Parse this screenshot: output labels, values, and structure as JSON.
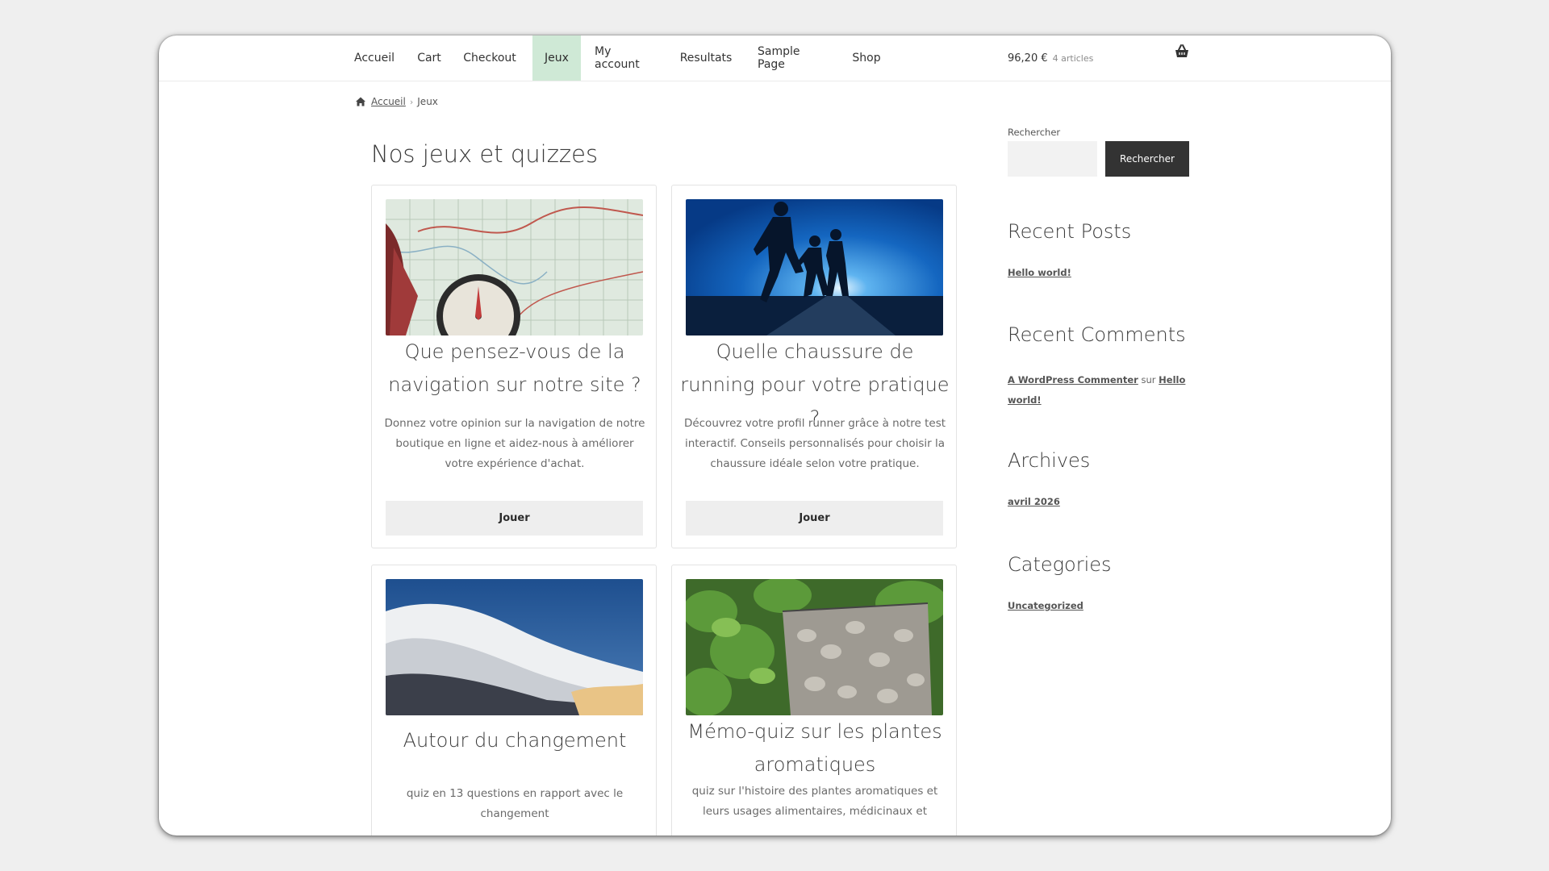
{
  "nav": {
    "items": [
      "Accueil",
      "Cart",
      "Checkout",
      "Jeux",
      "My account",
      "Resultats",
      "Sample Page",
      "Shop"
    ],
    "active": "Jeux"
  },
  "cart": {
    "total": "96,20 €",
    "count": "4 articles"
  },
  "breadcrumb": {
    "home": "Accueil",
    "current": "Jeux"
  },
  "page": {
    "title": "Nos jeux et quizzes"
  },
  "cards": [
    {
      "title": "Que pensez-vous de la navigation sur notre site ?",
      "description": "Donnez votre opinion sur la navigation de notre boutique en ligne et aidez-nous à améliorer votre expérience d'achat.",
      "button": "Jouer",
      "image": "map-compass-image"
    },
    {
      "title": "Quelle chaussure de running pour votre pratique ?",
      "description": "Découvrez votre profil runner grâce à notre test interactif. Conseils personnalisés pour choisir la chaussure idéale selon votre pratique.",
      "button": "Jouer",
      "image": "runners-image"
    },
    {
      "title": "Autour du changement",
      "description": "quiz en 13 questions en rapport avec le changement",
      "image": "clouds-sky-image"
    },
    {
      "title": "Mémo-quiz sur les plantes aromatiques",
      "description": "quiz sur l'histoire des plantes aromatiques et leurs usages alimentaires, médicinaux et",
      "image": "herb-garden-image"
    }
  ],
  "sidebar": {
    "search_label": "Rechercher",
    "search_button": "Rechercher",
    "recent_posts_title": "Recent Posts",
    "recent_posts": [
      "Hello world!"
    ],
    "recent_comments_title": "Recent Comments",
    "comment": {
      "author": "A WordPress Commenter",
      "on": "sur",
      "post": "Hello world!"
    },
    "archives_title": "Archives",
    "archives": [
      "avril 2026"
    ],
    "categories_title": "Categories",
    "categories": [
      "Uncategorized"
    ]
  },
  "colors": {
    "active_tab": "#cfe9d6",
    "search_button": "#333333",
    "button_bg": "#eeeeee"
  }
}
